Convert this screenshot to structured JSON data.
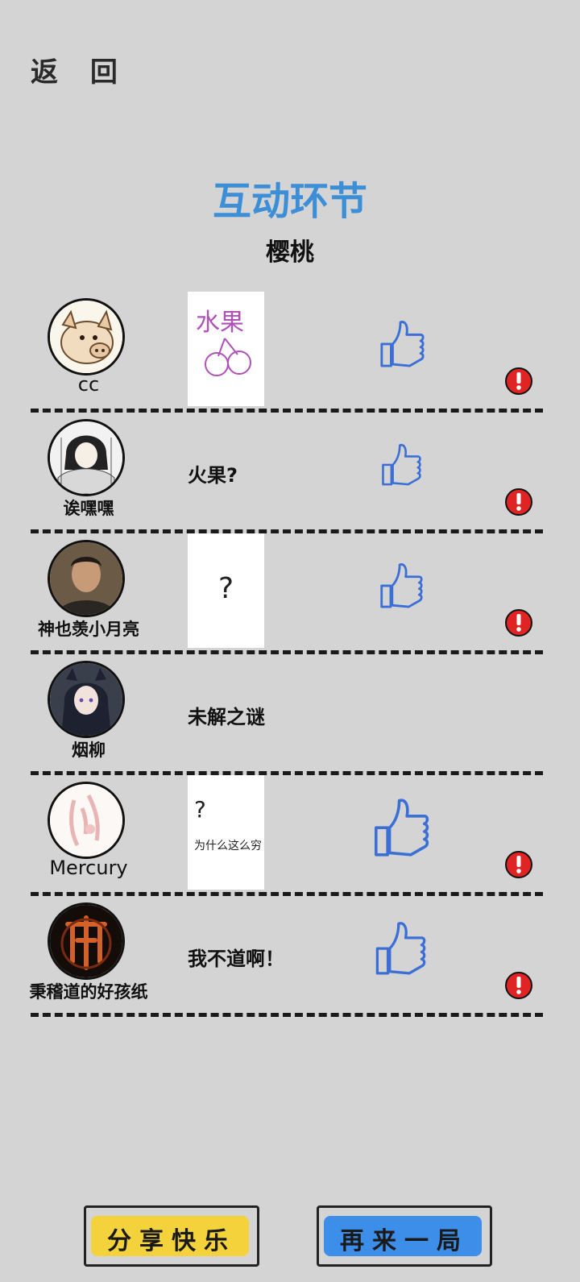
{
  "header": {
    "back_label": "返 回"
  },
  "title": "互动环节",
  "word": "樱桃",
  "entries": [
    {
      "name": "cc",
      "answer_type": "drawing",
      "answer_text": "",
      "drawing_text": "水果",
      "avatar_icon": "pig-avatar"
    },
    {
      "name": "诶嘿嘿",
      "answer_type": "text",
      "answer_text": "火果?",
      "drawing_text": "",
      "avatar_icon": "anime-avatar"
    },
    {
      "name": "神也羡小月亮",
      "answer_type": "drawing",
      "answer_text": "",
      "drawing_text": "?",
      "avatar_icon": "photo-avatar"
    },
    {
      "name": "烟柳",
      "answer_type": "text",
      "answer_text": "未解之谜",
      "drawing_text": "",
      "avatar_icon": "anime-girl-avatar"
    },
    {
      "name": "Mercury",
      "answer_type": "drawing",
      "answer_text": "",
      "drawing_text": "?",
      "drawing_note": "为什么这么穷",
      "avatar_icon": "sketch-avatar"
    },
    {
      "name": "秉稽道的好孩纸",
      "answer_type": "text",
      "answer_text": "我不道啊！",
      "drawing_text": "",
      "avatar_icon": "emblem-avatar"
    }
  ],
  "buttons": {
    "share_label": "分享快乐",
    "again_label": "再来一局"
  },
  "colors": {
    "accent": "#3c8ed6",
    "background": "#d4d4d4",
    "report": "#e02424",
    "share_fill": "#f4d23c",
    "again_fill": "#3d8ee8"
  }
}
